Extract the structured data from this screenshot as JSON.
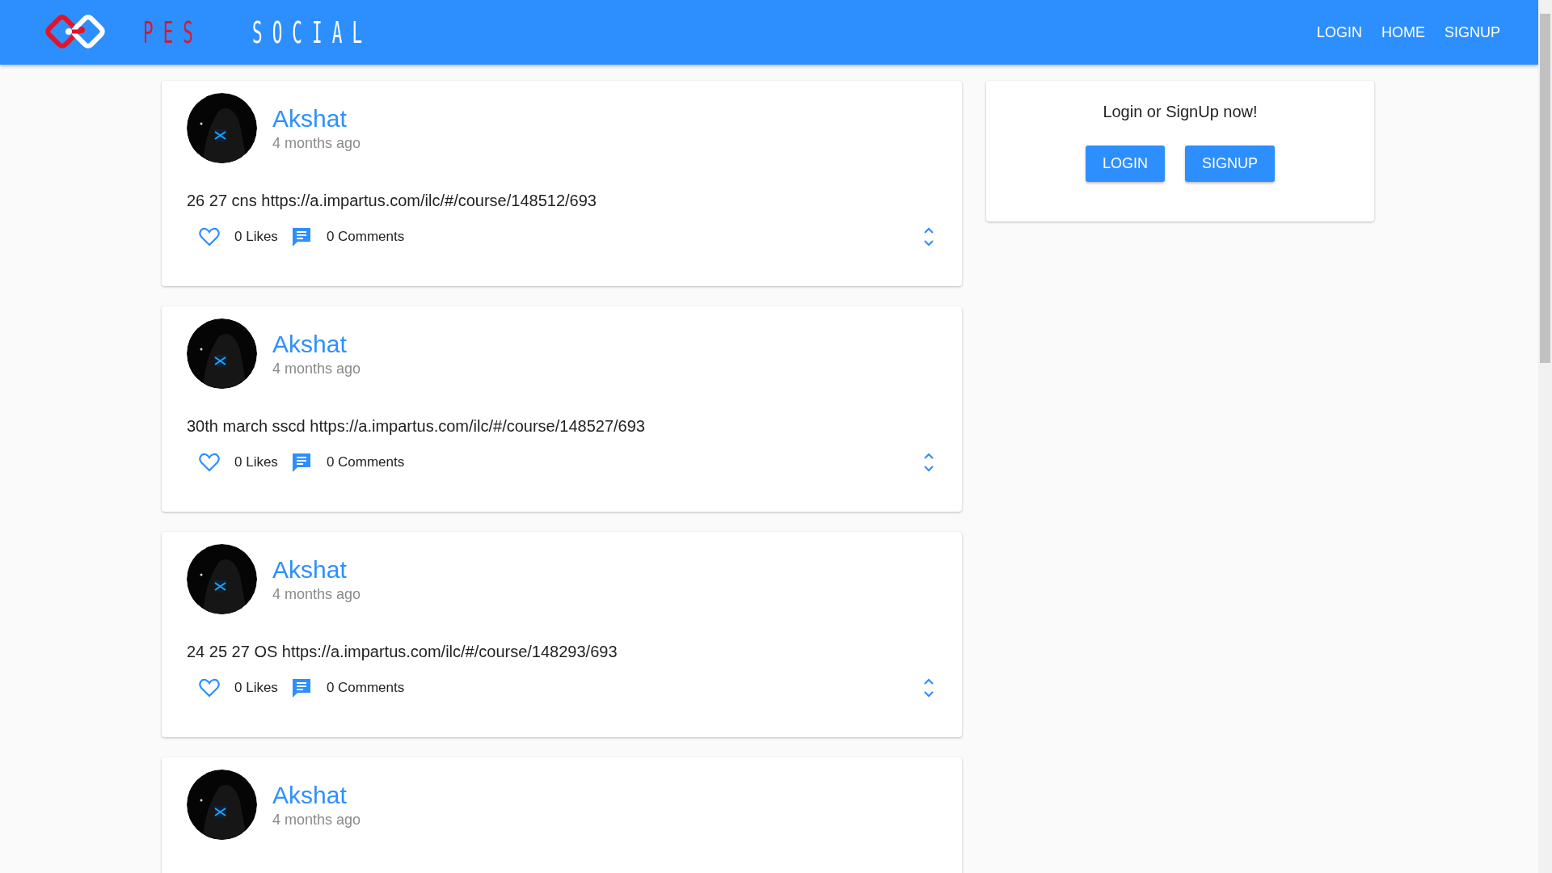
{
  "header": {
    "brand": [
      {
        "text": "PES",
        "color": "#e0152b"
      },
      {
        "text": "SOCIAL",
        "color": "#ffffff"
      }
    ],
    "nav": [
      "LOGIN",
      "HOME",
      "SIGNUP"
    ]
  },
  "posts": [
    {
      "author": "Akshat",
      "time": "4 months ago",
      "body": "26 27 cns https://a.impartus.com/ilc/#/course/148512/693",
      "likes": "0 Likes",
      "comments": "0 Comments"
    },
    {
      "author": "Akshat",
      "time": "4 months ago",
      "body": "30th march sscd https://a.impartus.com/ilc/#/course/148527/693",
      "likes": "0 Likes",
      "comments": "0 Comments"
    },
    {
      "author": "Akshat",
      "time": "4 months ago",
      "body": "24 25 27 OS https://a.impartus.com/ilc/#/course/148293/693",
      "likes": "0 Likes",
      "comments": "0 Comments"
    },
    {
      "author": "Akshat",
      "time": "4 months ago"
    }
  ],
  "sidebar": {
    "prompt": "Login or SignUp now!",
    "buttons": [
      "LOGIN",
      "SIGNUP"
    ]
  }
}
